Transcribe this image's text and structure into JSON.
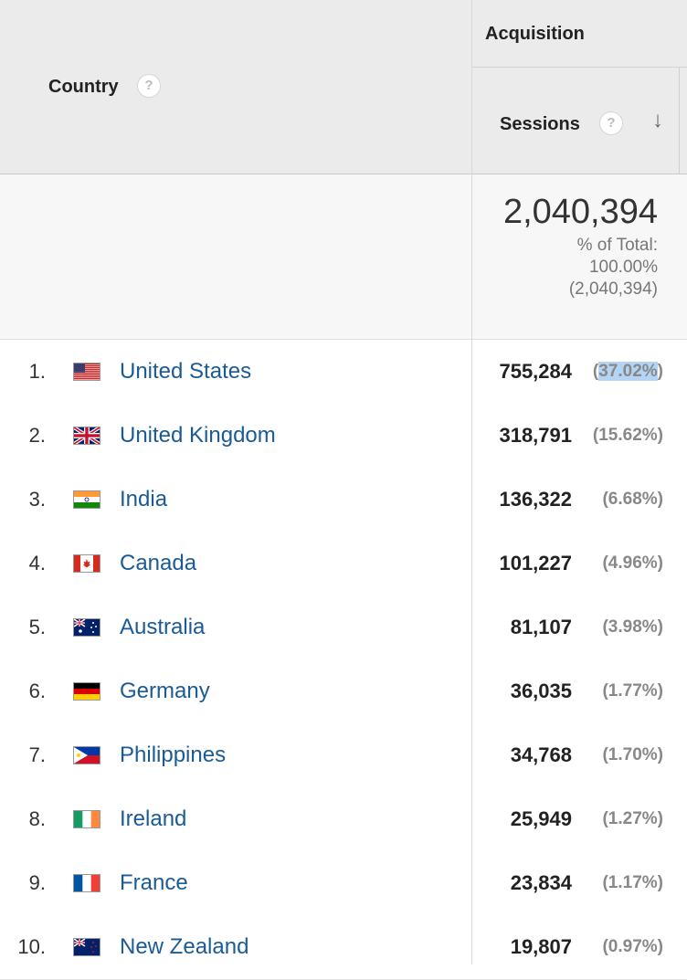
{
  "header": {
    "group_title": "Acquisition",
    "country_label": "Country",
    "sessions_label": "Sessions",
    "help_glyph": "?",
    "sort_arrow": "↓"
  },
  "totals": {
    "value": "2,040,394",
    "pct_label": "% of Total:",
    "pct_value": "100.00%",
    "pct_total": "(2,040,394)"
  },
  "rows": [
    {
      "rank": "1.",
      "country": "United States",
      "flag": "us-flag-icon",
      "sessions": "755,284",
      "pct": "(37.02%)"
    },
    {
      "rank": "2.",
      "country": "United Kingdom",
      "flag": "uk-flag-icon",
      "sessions": "318,791",
      "pct": "(15.62%)"
    },
    {
      "rank": "3.",
      "country": "India",
      "flag": "india-flag-icon",
      "sessions": "136,322",
      "pct": "(6.68%)"
    },
    {
      "rank": "4.",
      "country": "Canada",
      "flag": "canada-flag-icon",
      "sessions": "101,227",
      "pct": "(4.96%)"
    },
    {
      "rank": "5.",
      "country": "Australia",
      "flag": "australia-flag-icon",
      "sessions": "81,107",
      "pct": "(3.98%)"
    },
    {
      "rank": "6.",
      "country": "Germany",
      "flag": "germany-flag-icon",
      "sessions": "36,035",
      "pct": "(1.77%)"
    },
    {
      "rank": "7.",
      "country": "Philippines",
      "flag": "philippines-flag-icon",
      "sessions": "34,768",
      "pct": "(1.70%)"
    },
    {
      "rank": "8.",
      "country": "Ireland",
      "flag": "ireland-flag-icon",
      "sessions": "25,949",
      "pct": "(1.27%)"
    },
    {
      "rank": "9.",
      "country": "France",
      "flag": "france-flag-icon",
      "sessions": "23,834",
      "pct": "(1.17%)"
    },
    {
      "rank": "10.",
      "country": "New Zealand",
      "flag": "new-zealand-flag-icon",
      "sessions": "19,807",
      "pct": "(0.97%)"
    }
  ],
  "selection": {
    "row": 0,
    "text": "37.02%"
  },
  "colors": {
    "link": "#1a5a96",
    "header_bg": "#ebebeb",
    "totals_bg": "#f7f7f7",
    "selection": "#b3d4f5"
  }
}
